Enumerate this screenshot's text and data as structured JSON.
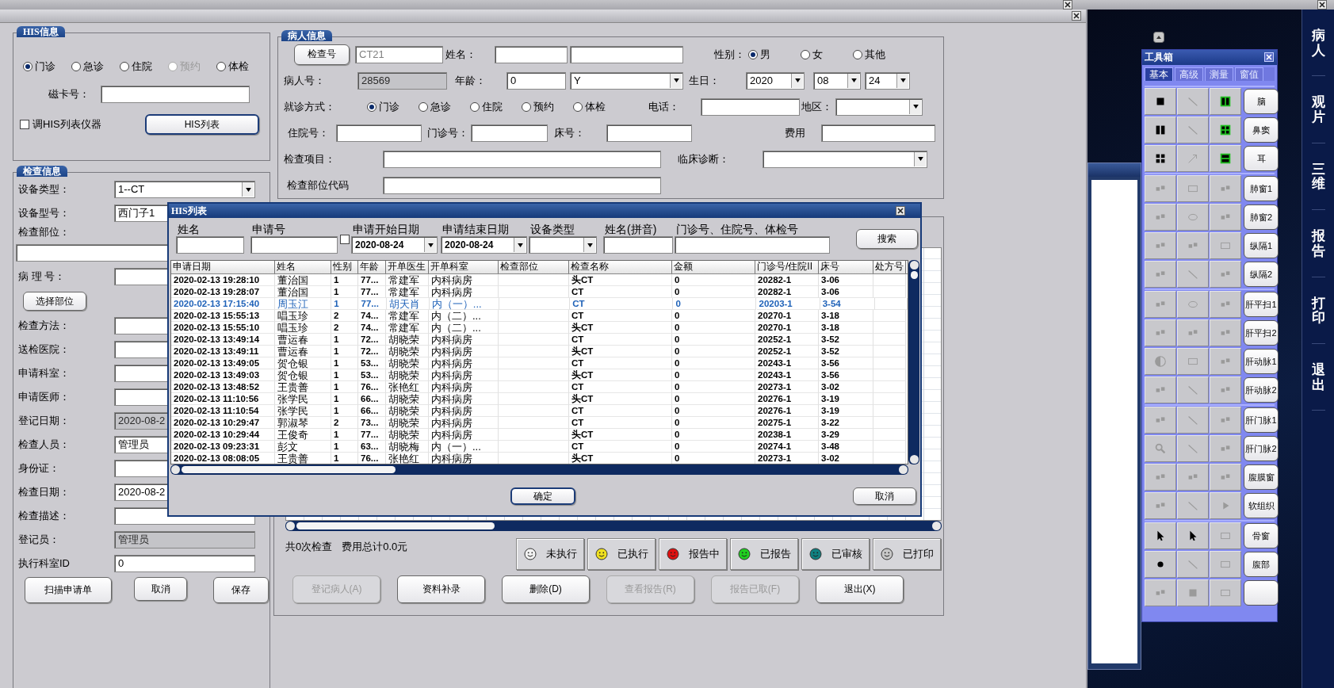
{
  "his_info": {
    "title": "HIS信息",
    "visit_types": [
      {
        "label": "门诊",
        "selected": true,
        "disabled": false
      },
      {
        "label": "急诊",
        "selected": false,
        "disabled": false
      },
      {
        "label": "住院",
        "selected": false,
        "disabled": false
      },
      {
        "label": "预约",
        "selected": false,
        "disabled": true
      },
      {
        "label": "体检",
        "selected": false,
        "disabled": false
      }
    ],
    "card_label": "磁卡号：",
    "instrument_checkbox": {
      "label": "调HIS列表仪器",
      "checked": false
    },
    "his_list_button": "HIS列表"
  },
  "patient_info": {
    "title": "病人信息",
    "exam_no_button": "检查号",
    "exam_no": "CT21",
    "name_label": "姓名：",
    "gender_label": "性别：",
    "genders": [
      {
        "label": "男",
        "selected": true
      },
      {
        "label": "女",
        "selected": false
      },
      {
        "label": "其他",
        "selected": false
      }
    ],
    "patient_no_label": "病人号：",
    "patient_no": "28569",
    "age_label": "年龄：",
    "age": "0",
    "age_unit": "Y",
    "birthday_label": "生日：",
    "birth_year": "2020",
    "birth_month": "08",
    "birth_day": "24",
    "visit_label": "就诊方式：",
    "visit_types": [
      {
        "label": "门诊",
        "selected": true
      },
      {
        "label": "急诊",
        "selected": false
      },
      {
        "label": "住院",
        "selected": false
      },
      {
        "label": "预约",
        "selected": false
      },
      {
        "label": "体检",
        "selected": false
      }
    ],
    "phone_label": "电话：",
    "region_label": "地区：",
    "inpatient_no_label": "住院号：",
    "outpatient_no_label": "门诊号：",
    "bed_label": "床号：",
    "fee_label": "费用",
    "exam_item_label": "检查项目：",
    "diagnosis_label": "临床诊断：",
    "body_code_label": "检查部位代码"
  },
  "exam_info": {
    "title": "检查信息",
    "fields": [
      {
        "kind": "select",
        "label": "设备类型：",
        "value": "1--CT"
      },
      {
        "kind": "select",
        "label": "设备型号：",
        "value": "西门子1"
      },
      {
        "kind": "wide",
        "label": "检查部位："
      },
      {
        "kind": "input",
        "label": "病 理 号："
      },
      {
        "kind": "button",
        "label": "选择部位"
      },
      {
        "kind": "input",
        "label": "检查方法："
      },
      {
        "kind": "input",
        "label": "送检医院："
      },
      {
        "kind": "input",
        "label": "申请科室："
      },
      {
        "kind": "input",
        "label": "申请医师："
      },
      {
        "kind": "readonly",
        "label": "登记日期：",
        "value": "2020-08-2"
      },
      {
        "kind": "input",
        "label": "检查人员：",
        "value": "管理员"
      },
      {
        "kind": "input",
        "label": "身份证："
      },
      {
        "kind": "input",
        "label": "检查日期：",
        "value": "2020-08-2"
      },
      {
        "kind": "input",
        "label": "检查描述："
      },
      {
        "kind": "readonly",
        "label": "登记员：",
        "value": "管理员"
      },
      {
        "kind": "input",
        "label": "执行科室ID",
        "value": "0"
      }
    ],
    "buttons": [
      "扫描申请单",
      "取消",
      "保存"
    ]
  },
  "records": {
    "summary_count": "共0次检查",
    "summary_fee": "费用总计0.0元",
    "legend": [
      {
        "label": "未执行",
        "color": "#f2f2f2"
      },
      {
        "label": "已执行",
        "color": "#f0e020"
      },
      {
        "label": "报告中",
        "color": "#e01010"
      },
      {
        "label": "已报告",
        "color": "#20d020"
      },
      {
        "label": "已审核",
        "color": "#108080"
      },
      {
        "label": "已打印",
        "color": "#c8c8c8"
      }
    ],
    "actions": [
      {
        "label": "登记病人(A)",
        "disabled": true
      },
      {
        "label": "资料补录",
        "disabled": false
      },
      {
        "label": "删除(D)",
        "disabled": false
      },
      {
        "label": "查看报告(R)",
        "disabled": true
      },
      {
        "label": "报告已取(F)",
        "disabled": true
      },
      {
        "label": "退出(X)",
        "disabled": false
      }
    ]
  },
  "his_list": {
    "title": "HIS列表",
    "filters": [
      {
        "kind": "input",
        "label": "姓名"
      },
      {
        "kind": "input",
        "label": "申请号"
      },
      {
        "kind": "date",
        "label": "申请开始日期",
        "value": "2020-08-24"
      },
      {
        "kind": "date",
        "label": "申请结束日期",
        "value": "2020-08-24"
      },
      {
        "kind": "select",
        "label": "设备类型"
      },
      {
        "kind": "input",
        "label": "姓名(拼音)"
      },
      {
        "kind": "input",
        "label": "门诊号、住院号、体检号"
      }
    ],
    "date_checkbox_checked": false,
    "search_button": "搜索",
    "columns": [
      "申请日期",
      "姓名",
      "性别",
      "年龄",
      "开单医生",
      "开单科室",
      "检查部位",
      "检查名称",
      "金额",
      "门诊号/住院II",
      "床号",
      "处方号"
    ],
    "rows": [
      {
        "date": "2020-02-13 19:28:10",
        "name": "董治国",
        "sex": "1",
        "age": "77...",
        "doctor": "常建军",
        "dept": "内科病房",
        "exam": "头CT",
        "amount": "0",
        "visit_no": "20282-1",
        "bed": "3-06",
        "selected": false
      },
      {
        "date": "2020-02-13 19:28:07",
        "name": "董治国",
        "sex": "1",
        "age": "77...",
        "doctor": "常建军",
        "dept": "内科病房",
        "exam": "CT",
        "amount": "0",
        "visit_no": "20282-1",
        "bed": "3-06",
        "selected": false
      },
      {
        "date": "2020-02-13 17:15:40",
        "name": "周玉江",
        "sex": "1",
        "age": "77...",
        "doctor": "胡天肖",
        "dept": "内（一）...",
        "exam": "CT",
        "amount": "0",
        "visit_no": "20203-1",
        "bed": "3-54",
        "selected": true
      },
      {
        "date": "2020-02-13 15:55:13",
        "name": "唱玉珍",
        "sex": "2",
        "age": "74...",
        "doctor": "常建军",
        "dept": "内（二）...",
        "exam": "CT",
        "amount": "0",
        "visit_no": "20270-1",
        "bed": "3-18",
        "selected": false
      },
      {
        "date": "2020-02-13 15:55:10",
        "name": "唱玉珍",
        "sex": "2",
        "age": "74...",
        "doctor": "常建军",
        "dept": "内（二）...",
        "exam": "头CT",
        "amount": "0",
        "visit_no": "20270-1",
        "bed": "3-18",
        "selected": false
      },
      {
        "date": "2020-02-13 13:49:14",
        "name": "曹运春",
        "sex": "1",
        "age": "72...",
        "doctor": "胡晓荣",
        "dept": "内科病房",
        "exam": "CT",
        "amount": "0",
        "visit_no": "20252-1",
        "bed": "3-52",
        "selected": false
      },
      {
        "date": "2020-02-13 13:49:11",
        "name": "曹运春",
        "sex": "1",
        "age": "72...",
        "doctor": "胡晓荣",
        "dept": "内科病房",
        "exam": "头CT",
        "amount": "0",
        "visit_no": "20252-1",
        "bed": "3-52",
        "selected": false
      },
      {
        "date": "2020-02-13 13:49:05",
        "name": "贺仓银",
        "sex": "1",
        "age": "53...",
        "doctor": "胡晓荣",
        "dept": "内科病房",
        "exam": "CT",
        "amount": "0",
        "visit_no": "20243-1",
        "bed": "3-56",
        "selected": false
      },
      {
        "date": "2020-02-13 13:49:03",
        "name": "贺仓银",
        "sex": "1",
        "age": "53...",
        "doctor": "胡晓荣",
        "dept": "内科病房",
        "exam": "头CT",
        "amount": "0",
        "visit_no": "20243-1",
        "bed": "3-56",
        "selected": false
      },
      {
        "date": "2020-02-13 13:48:52",
        "name": "王贵善",
        "sex": "1",
        "age": "76...",
        "doctor": "张艳红",
        "dept": "内科病房",
        "exam": "CT",
        "amount": "0",
        "visit_no": "20273-1",
        "bed": "3-02",
        "selected": false
      },
      {
        "date": "2020-02-13 11:10:56",
        "name": "张学民",
        "sex": "1",
        "age": "66...",
        "doctor": "胡晓荣",
        "dept": "内科病房",
        "exam": "头CT",
        "amount": "0",
        "visit_no": "20276-1",
        "bed": "3-19",
        "selected": false
      },
      {
        "date": "2020-02-13 11:10:54",
        "name": "张学民",
        "sex": "1",
        "age": "66...",
        "doctor": "胡晓荣",
        "dept": "内科病房",
        "exam": "CT",
        "amount": "0",
        "visit_no": "20276-1",
        "bed": "3-19",
        "selected": false
      },
      {
        "date": "2020-02-13 10:29:47",
        "name": "郭淑琴",
        "sex": "2",
        "age": "73...",
        "doctor": "胡晓荣",
        "dept": "内科病房",
        "exam": "CT",
        "amount": "0",
        "visit_no": "20275-1",
        "bed": "3-22",
        "selected": false
      },
      {
        "date": "2020-02-13 10:29:44",
        "name": "王俊奇",
        "sex": "1",
        "age": "77...",
        "doctor": "胡晓荣",
        "dept": "内科病房",
        "exam": "头CT",
        "amount": "0",
        "visit_no": "20238-1",
        "bed": "3-29",
        "selected": false
      },
      {
        "date": "2020-02-13 09:23:31",
        "name": "彭文",
        "sex": "1",
        "age": "63...",
        "doctor": "胡晓梅",
        "dept": "内（一）...",
        "exam": "CT",
        "amount": "0",
        "visit_no": "20274-1",
        "bed": "3-48",
        "selected": false
      },
      {
        "date": "2020-02-13 08:08:05",
        "name": "王贵善",
        "sex": "1",
        "age": "76...",
        "doctor": "张艳红",
        "dept": "内科病房",
        "exam": "头CT",
        "amount": "0",
        "visit_no": "20273-1",
        "bed": "3-02",
        "selected": false
      }
    ],
    "ok_button": "确定",
    "cancel_button": "取消"
  },
  "toolbox": {
    "title": "工具箱",
    "tabs": [
      {
        "label": "基本",
        "selected": true
      },
      {
        "label": "高级",
        "selected": false
      },
      {
        "label": "测量",
        "selected": false
      },
      {
        "label": "窗值",
        "selected": false
      }
    ],
    "rows": [
      {
        "preset": "脑",
        "tools_enabled": [
          true,
          false,
          true
        ]
      },
      {
        "preset": "鼻窦",
        "tools_enabled": [
          true,
          false,
          true
        ]
      },
      {
        "preset": "耳",
        "tools_enabled": [
          true,
          false,
          true
        ]
      },
      {
        "preset": "肺窗1",
        "tools_enabled": [
          false,
          false,
          false
        ]
      },
      {
        "preset": "肺窗2",
        "tools_enabled": [
          false,
          false,
          false
        ]
      },
      {
        "preset": "纵隔1",
        "tools_enabled": [
          false,
          false,
          false
        ]
      },
      {
        "preset": "纵隔2",
        "tools_enabled": [
          false,
          false,
          false
        ]
      },
      {
        "preset": "肝平扫1",
        "tools_enabled": [
          false,
          false,
          false
        ]
      },
      {
        "preset": "肝平扫2",
        "tools_enabled": [
          false,
          false,
          false
        ]
      },
      {
        "preset": "肝动脉1",
        "tools_enabled": [
          false,
          false,
          false
        ]
      },
      {
        "preset": "肝动脉2",
        "tools_enabled": [
          false,
          false,
          false
        ]
      },
      {
        "preset": "肝门脉1",
        "tools_enabled": [
          false,
          false,
          false
        ]
      },
      {
        "preset": "肝门脉2",
        "tools_enabled": [
          false,
          false,
          false
        ]
      },
      {
        "preset": "腹膜窗",
        "tools_enabled": [
          false,
          false,
          false
        ]
      },
      {
        "preset": "软组织",
        "tools_enabled": [
          false,
          false,
          false
        ]
      },
      {
        "preset": "骨窗",
        "tools_enabled": [
          true,
          true,
          false
        ]
      },
      {
        "preset": "腹部",
        "tools_enabled": [
          true,
          false,
          false
        ]
      },
      {
        "tools_enabled": [
          false,
          false,
          false
        ]
      }
    ]
  },
  "side_nav": [
    "病人",
    "观片",
    "三维",
    "报告",
    "打印",
    "退出"
  ]
}
